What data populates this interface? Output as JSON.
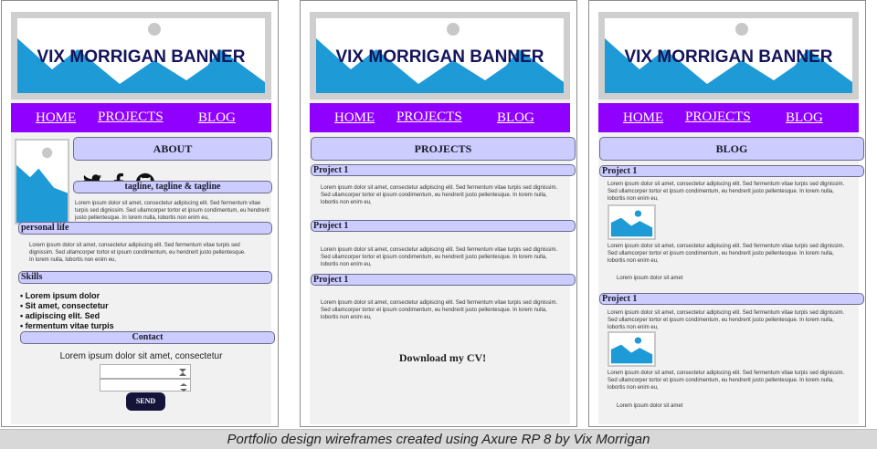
{
  "banner": {
    "title": "VIX MORRIGAN BANNER"
  },
  "nav": {
    "home": "HOME",
    "projects": "PROJECTS",
    "blog": "BLOG"
  },
  "about_page": {
    "heading": "ABOUT",
    "tagline": "tagline, tagline & tagline",
    "intro": "Lorem ipsum dolor sit amet, consectetur adipiscing elit. Sed fermentum vitae turpis sed dignissim. Sed ullamcorper tortor et ipsum condimentum, eu hendrerit justo pellentesque. In lorem nulla, lobortis non enim eu,",
    "personal_heading": "personal life",
    "personal_text": "Lorem ipsum dolor sit amet, consectetur adipiscing elit. Sed fermentum vitae turpis sed dignissim. Sed ullamcorper tortor et ipsum condimentum, eu hendrerit justo pellentesque. In lorem nulla, lobortis non enim eu,",
    "skills_heading": "Skills",
    "skills": [
      "Lorem ipsum dolor",
      "Sit amet, consectetur",
      "adipiscing elit. Sed",
      "fermentum vitae turpis"
    ],
    "contact_heading": "Contact",
    "contact_text": "Lorem ipsum dolor sit amet, consectetur",
    "send_label": "SEND",
    "social_icons": [
      "twitter-icon",
      "facebook-icon",
      "github-icon"
    ]
  },
  "projects_page": {
    "heading": "PROJECTS",
    "items": [
      {
        "title": "Project 1",
        "text": "Lorem ipsum dolor sit amet, consectetur adipiscing elit. Sed fermentum vitae turpis sed dignissim. Sed ullamcorper tortor et ipsum condimentum, eu hendrerit justo pellentesque. In lorem nulla, lobortis non enim eu,"
      },
      {
        "title": "Project 1",
        "text": "Lorem ipsum dolor sit amet, consectetur adipiscing elit. Sed fermentum vitae turpis sed dignissim. Sed ullamcorper tortor et ipsum condimentum, eu hendrerit justo pellentesque. In lorem nulla, lobortis non enim eu,"
      },
      {
        "title": "Project 1",
        "text": "Lorem ipsum dolor sit amet, consectetur adipiscing elit. Sed fermentum vitae turpis sed dignissim. Sed ullamcorper tortor et ipsum condimentum, eu hendrerit justo pellentesque. In lorem nulla, lobortis non enim eu,"
      }
    ],
    "cv_link": "Download my CV!"
  },
  "blog_page": {
    "heading": "BLOG",
    "posts": [
      {
        "title": "Project 1",
        "text1": "Lorem ipsum dolor sit amet, consectetur adipiscing elit. Sed fermentum vitae turpis sed dignissim. Sed ullamcorper tortor et ipsum condimentum, eu hendrerit justo pellentesque. In lorem nulla, lobortis non enim eu,",
        "text2": "Lorem ipsum dolor sit amet, consectetur adipiscing elit. Sed fermentum vitae turpis sed dignissim. Sed ullamcorper tortor et ipsum condimentum, eu hendrerit justo pellentesque. In lorem nulla, lobortis non enim eu,",
        "short": "Lorem ipsum dolor sit amet"
      },
      {
        "title": "Project 1",
        "text1": "Lorem ipsum dolor sit amet, consectetur adipiscing elit. Sed fermentum vitae turpis sed dignissim. Sed ullamcorper tortor et ipsum condimentum, eu hendrerit justo pellentesque. In lorem nulla, lobortis non enim eu,",
        "text2": "Lorem ipsum dolor sit amet, consectetur adipiscing elit. Sed fermentum vitae turpis sed dignissim. Sed ullamcorper tortor et ipsum condimentum, eu hendrerit justo pellentesque. In lorem nulla, lobortis non enim eu,",
        "short": "Lorem ipsum dolor sit amet"
      }
    ]
  },
  "caption": "Portfolio design wireframes created using Axure RP 8 by Vix Morrigan",
  "colors": {
    "nav": "#9000ff",
    "pill": "#ccccff",
    "image_blue": "#1e9bd7",
    "send_button": "#14143a"
  }
}
